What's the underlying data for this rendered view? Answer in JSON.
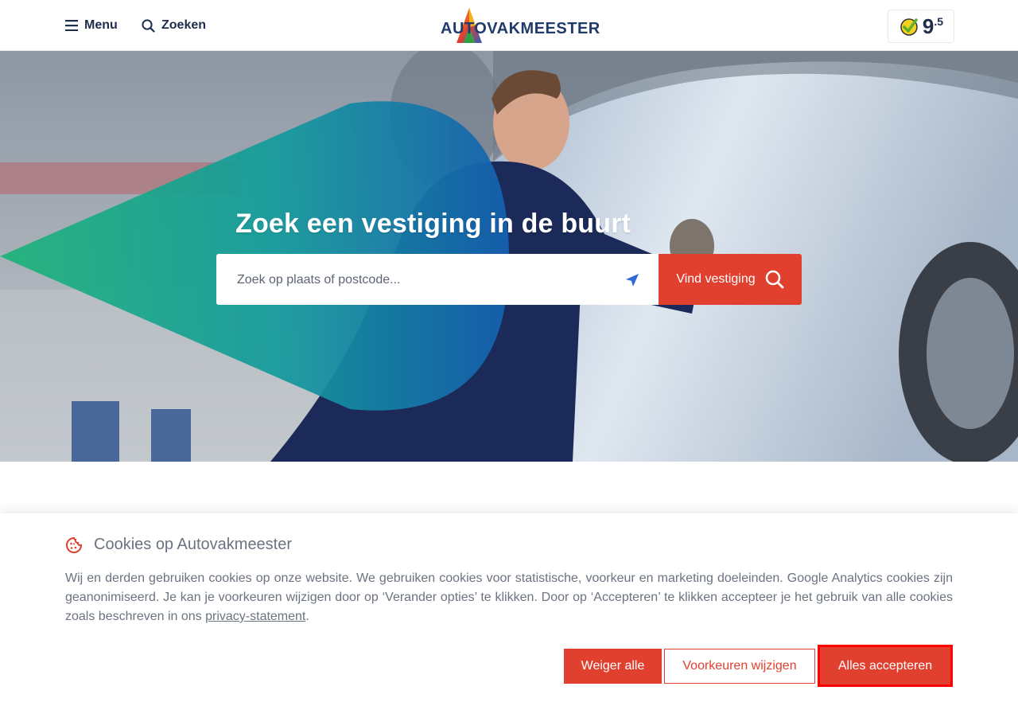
{
  "header": {
    "menu_label": "Menu",
    "search_label": "Zoeken",
    "logo_text": "AUTOVAKMEESTER",
    "rating_score": "9",
    "rating_decimal": ".5"
  },
  "hero": {
    "title": "Zoek een vestiging in de buurt",
    "search_placeholder": "Zoek op plaats of postcode...",
    "find_button_label": "Vind vestiging"
  },
  "cookie_banner": {
    "title": "Cookies op Autovakmeester",
    "text": "Wij en derden gebruiken cookies op onze website. We gebruiken cookies voor statistische, voorkeur en marketing doeleinden. Google Analytics cookies zijn geanonimiseerd. Je kan je voorkeuren wijzigen door op ‘Verander opties’ te klikken. Door op ‘Accepteren’ te klikken accepteer je het gebruik van alle cookies zoals beschreven in ons ",
    "link_text": "privacy-statement",
    "text_end": ".",
    "reject_label": "Weiger alle",
    "prefs_label": "Voorkeuren wijzigen",
    "accept_label": "Alles accepteren"
  },
  "colors": {
    "brand_red": "#e2402f",
    "navy": "#1f2d4d",
    "highlight": "#ff0000"
  },
  "icons": [
    "hamburger-icon",
    "search-icon",
    "logo-mark",
    "kiyoh-check-icon",
    "location-arrow-icon",
    "cookie-icon"
  ]
}
